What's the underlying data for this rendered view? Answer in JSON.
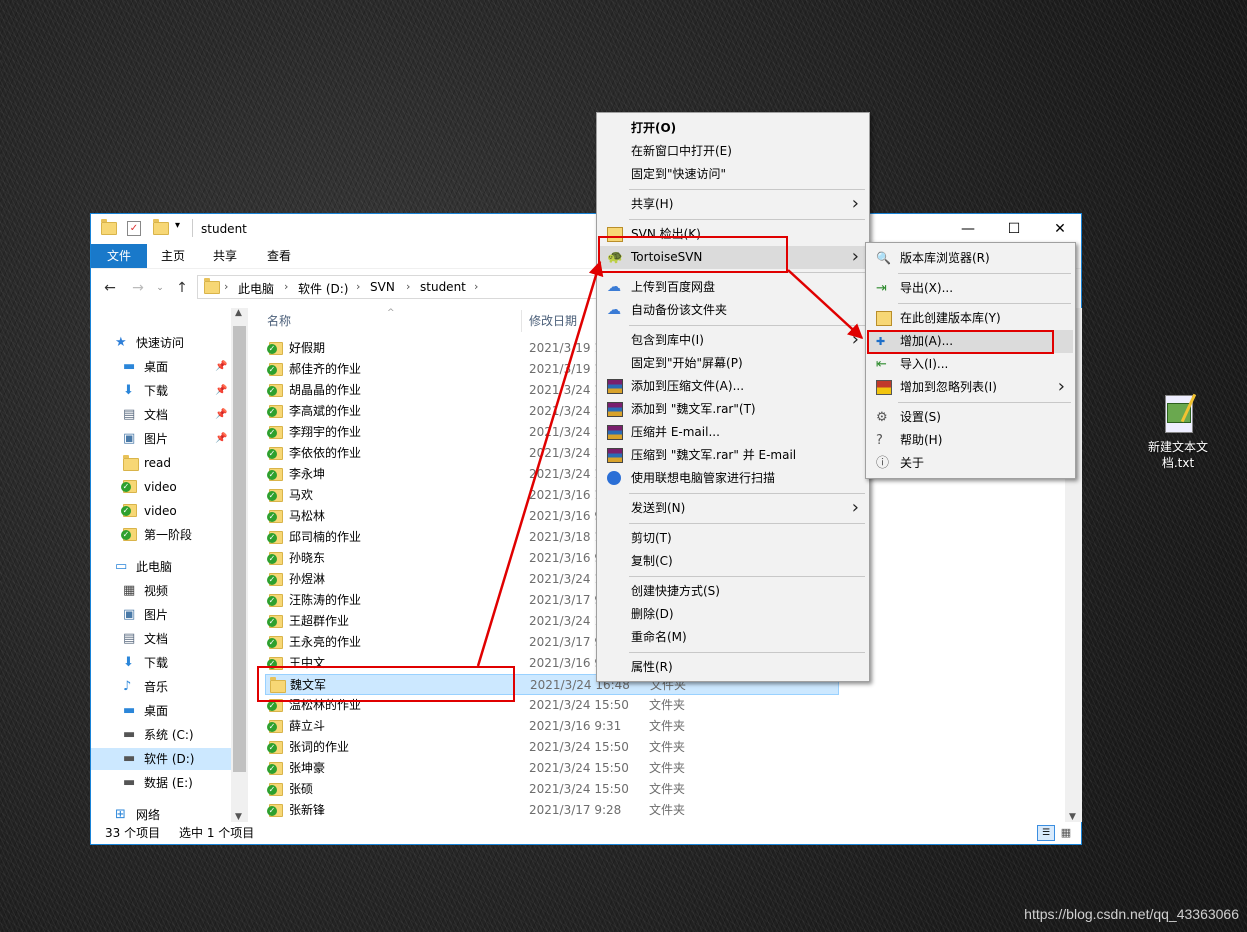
{
  "window": {
    "title": "student",
    "ribbon_tabs": [
      "文件",
      "主页",
      "共享",
      "查看"
    ],
    "breadcrumb": [
      "此电脑",
      "软件 (D:)",
      "SVN",
      "student"
    ]
  },
  "nav": [
    {
      "label": "快速访问",
      "icon": "star-icon",
      "header": true,
      "pin": false
    },
    {
      "label": "桌面",
      "icon": "desktop-icon",
      "header": false,
      "pin": true
    },
    {
      "label": "下载",
      "icon": "download-icon",
      "header": false,
      "pin": true
    },
    {
      "label": "文档",
      "icon": "document-icon",
      "header": false,
      "pin": true
    },
    {
      "label": "图片",
      "icon": "picture-icon",
      "header": false,
      "pin": true
    },
    {
      "label": "read",
      "icon": "folder-icon",
      "header": false,
      "pin": false
    },
    {
      "label": "video",
      "icon": "svn-folder-icon",
      "header": false,
      "pin": false
    },
    {
      "label": "video",
      "icon": "svn-folder-icon",
      "header": false,
      "pin": false
    },
    {
      "label": "第一阶段",
      "icon": "svn-folder-icon",
      "header": false,
      "pin": false
    },
    {
      "label": "此电脑",
      "icon": "computer-icon",
      "header": true,
      "pin": false
    },
    {
      "label": "视频",
      "icon": "video-icon",
      "header": false,
      "pin": false
    },
    {
      "label": "图片",
      "icon": "picture-icon",
      "header": false,
      "pin": false
    },
    {
      "label": "文档",
      "icon": "document-icon",
      "header": false,
      "pin": false
    },
    {
      "label": "下载",
      "icon": "download-icon",
      "header": false,
      "pin": false
    },
    {
      "label": "音乐",
      "icon": "music-icon",
      "header": false,
      "pin": false
    },
    {
      "label": "桌面",
      "icon": "desktop-icon",
      "header": false,
      "pin": false
    },
    {
      "label": "系统 (C:)",
      "icon": "drive-icon",
      "header": false,
      "pin": false
    },
    {
      "label": "软件 (D:)",
      "icon": "drive-icon",
      "header": false,
      "pin": false,
      "selected": true
    },
    {
      "label": "数据 (E:)",
      "icon": "drive-icon",
      "header": false,
      "pin": false
    },
    {
      "label": "网络",
      "icon": "network-icon",
      "header": true,
      "pin": false
    }
  ],
  "columns": {
    "name": "名称",
    "date": "修改日期"
  },
  "files": [
    {
      "name": "好假期",
      "date": "2021/3/19 1",
      "type": ""
    },
    {
      "name": "郝佳齐的作业",
      "date": "2021/3/19 1",
      "type": ""
    },
    {
      "name": "胡晶晶的作业",
      "date": "2021/3/24 1",
      "type": ""
    },
    {
      "name": "李高斌的作业",
      "date": "2021/3/24 1",
      "type": ""
    },
    {
      "name": "李翔宇的作业",
      "date": "2021/3/24 1",
      "type": ""
    },
    {
      "name": "李依依的作业",
      "date": "2021/3/24 1",
      "type": ""
    },
    {
      "name": "李永坤",
      "date": "2021/3/24 1",
      "type": ""
    },
    {
      "name": "马欢",
      "date": "2021/3/16 1",
      "type": ""
    },
    {
      "name": "马松林",
      "date": "2021/3/16 9",
      "type": ""
    },
    {
      "name": "邱司楠的作业",
      "date": "2021/3/18 1",
      "type": ""
    },
    {
      "name": "孙晓东",
      "date": "2021/3/16 9",
      "type": ""
    },
    {
      "name": "孙煜淋",
      "date": "2021/3/24 1",
      "type": ""
    },
    {
      "name": "汪陈涛的作业",
      "date": "2021/3/17 9",
      "type": ""
    },
    {
      "name": "王超群作业",
      "date": "2021/3/24 1",
      "type": ""
    },
    {
      "name": "王永亮的作业",
      "date": "2021/3/17 9",
      "type": ""
    },
    {
      "name": "王中文",
      "date": "2021/3/16 9",
      "type": ""
    },
    {
      "name": "魏文军",
      "date": "2021/3/24 16:48",
      "type": "文件夹",
      "selected": true
    },
    {
      "name": "温松林的作业",
      "date": "2021/3/24 15:50",
      "type": "文件夹"
    },
    {
      "name": "薛立斗",
      "date": "2021/3/16 9:31",
      "type": "文件夹"
    },
    {
      "name": "张词的作业",
      "date": "2021/3/24 15:50",
      "type": "文件夹"
    },
    {
      "name": "张坤豪",
      "date": "2021/3/24 15:50",
      "type": "文件夹"
    },
    {
      "name": "张硕",
      "date": "2021/3/24 15:50",
      "type": "文件夹"
    },
    {
      "name": "张新锋",
      "date": "2021/3/17 9:28",
      "type": "文件夹"
    }
  ],
  "status": {
    "count": "33 个项目",
    "selected": "选中 1 个项目"
  },
  "context_menu": [
    {
      "label": "打开(O)",
      "bold": true
    },
    {
      "label": "在新窗口中打开(E)"
    },
    {
      "label": "固定到\"快速访问\""
    },
    {
      "sep": true
    },
    {
      "label": "共享(H)",
      "submenu": true
    },
    {
      "sep": true
    },
    {
      "label": "SVN 检出(K)...",
      "icon": "svn-checkout-icon"
    },
    {
      "label": "TortoiseSVN",
      "icon": "tortoise-icon",
      "submenu": true,
      "highlight": true
    },
    {
      "sep": true
    },
    {
      "label": "上传到百度网盘",
      "icon": "baidu-cloud-icon"
    },
    {
      "label": "自动备份该文件夹",
      "icon": "baidu-cloud-icon"
    },
    {
      "sep": true
    },
    {
      "label": "包含到库中(I)",
      "submenu": true
    },
    {
      "label": "固定到\"开始\"屏幕(P)"
    },
    {
      "label": "添加到压缩文件(A)...",
      "icon": "winrar-icon"
    },
    {
      "label": "添加到 \"魏文军.rar\"(T)",
      "icon": "winrar-icon"
    },
    {
      "label": "压缩并 E-mail...",
      "icon": "winrar-icon"
    },
    {
      "label": "压缩到 \"魏文军.rar\" 并 E-mail",
      "icon": "winrar-icon"
    },
    {
      "label": "使用联想电脑管家进行扫描",
      "icon": "lenovo-icon"
    },
    {
      "sep": true
    },
    {
      "label": "发送到(N)",
      "submenu": true
    },
    {
      "sep": true
    },
    {
      "label": "剪切(T)"
    },
    {
      "label": "复制(C)"
    },
    {
      "sep": true
    },
    {
      "label": "创建快捷方式(S)"
    },
    {
      "label": "删除(D)"
    },
    {
      "label": "重命名(M)"
    },
    {
      "sep": true
    },
    {
      "label": "属性(R)"
    }
  ],
  "submenu": [
    {
      "label": "版本库浏览器(R)",
      "icon": "repo-browser-icon"
    },
    {
      "sep": true
    },
    {
      "label": "导出(X)...",
      "icon": "export-icon"
    },
    {
      "sep": true
    },
    {
      "label": "在此创建版本库(Y)",
      "icon": "create-repo-icon"
    },
    {
      "label": "增加(A)...",
      "icon": "add-icon",
      "highlight": true
    },
    {
      "label": "导入(I)...",
      "icon": "import-icon"
    },
    {
      "label": "增加到忽略列表(I)",
      "icon": "ignore-icon",
      "submenu": true
    },
    {
      "sep": true
    },
    {
      "label": "设置(S)",
      "icon": "settings-icon"
    },
    {
      "label": "帮助(H)",
      "icon": "help-icon"
    },
    {
      "label": "关于",
      "icon": "about-icon"
    }
  ],
  "desktop_icon": {
    "label": "新建文本文档.txt",
    "icon": "text-file-icon"
  },
  "watermark": "https://blog.csdn.net/qq_43363066",
  "colors": {
    "accent": "#1979ca",
    "selection": "#cce8ff",
    "annotation": "#e00000",
    "svn_check": "#2ea02e"
  }
}
